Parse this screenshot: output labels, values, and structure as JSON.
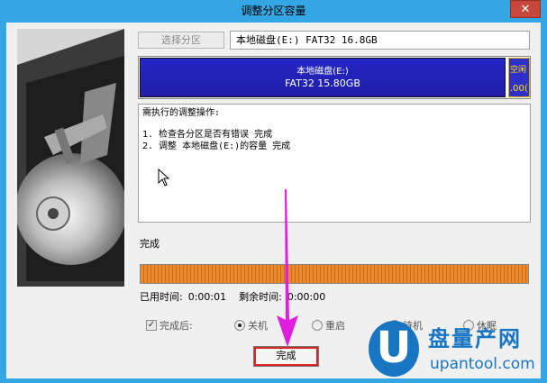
{
  "window": {
    "title": "调整分区容量",
    "close_glyph": "✕"
  },
  "header": {
    "select_partition_label": "选择分区",
    "disk_value": "本地磁盘(E:) FAT32 16.8GB"
  },
  "partition_map": {
    "main_name": "本地磁盘(E:)",
    "main_info": "FAT32 15.80GB",
    "free_label_top": "空闲",
    "free_label_bottom": ".00("
  },
  "log": {
    "heading": "需执行的调整操作:",
    "steps": [
      "1. 检查各分区是否有错误    完成",
      "2. 调整 本地磁盘(E:)的容量    完成"
    ]
  },
  "status": {
    "text": "完成",
    "progress": 1.0,
    "elapsed_label": "已用时间:",
    "elapsed_value": "0:00:01",
    "remaining_label": "剩余时间:",
    "remaining_value": "0:00:00"
  },
  "after_completion": {
    "checkbox_label": "完成后:",
    "checked": true,
    "options": [
      "关机",
      "重启",
      "待机",
      "休眠"
    ],
    "selected": "关机"
  },
  "finish_button_label": "完成",
  "watermark": {
    "logo_letter": "U",
    "cn_text": "盘量产网",
    "en_text": "upantool.com"
  },
  "colors": {
    "partition_fill": "#2626c9",
    "progress_fill": "#ec8a2d",
    "arrow": "#e01ee0",
    "highlight_border": "#dd2222",
    "watermark": "#1775c2"
  },
  "icons": {
    "disk_image": "hard-disk-illustration",
    "cursor": "mouse-pointer-icon",
    "annotation": "pointer-arrow-icon"
  }
}
